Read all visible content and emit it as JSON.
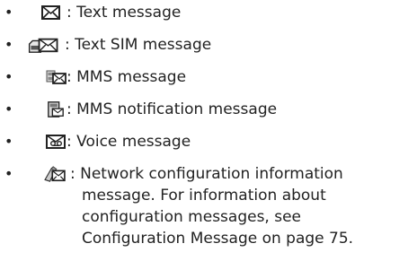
{
  "items": [
    {
      "bullet": "•",
      "label": ": Text message",
      "icon": "text-message-icon"
    },
    {
      "bullet": "•",
      "label": ": Text SIM message",
      "icon": "sim-message-icon"
    },
    {
      "bullet": "•",
      "label": ": MMS message",
      "icon": "mms-message-icon"
    },
    {
      "bullet": "•",
      "label": ": MMS notification message",
      "icon": "mms-notification-icon"
    },
    {
      "bullet": "•",
      "label": ": Voice message",
      "icon": "voice-message-icon"
    },
    {
      "bullet": "•",
      "label": ": Network configuration information",
      "icon": "network-config-icon",
      "continuation": [
        "message. For information about",
        "configuration messages, see",
        "Configuration Message on page 75."
      ]
    }
  ]
}
